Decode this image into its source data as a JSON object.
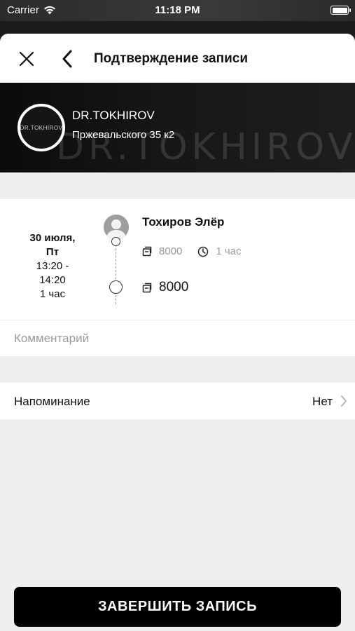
{
  "status_bar": {
    "carrier": "Carrier",
    "time": "11:18 PM"
  },
  "nav": {
    "title": "Подтверждение записи"
  },
  "banner": {
    "name": "DR.TOKHIROV",
    "address": "Пржевальского 35 к2",
    "avatar_text": "DR.TOKHIROV",
    "watermark": "DR.TOKHIROV"
  },
  "appointment": {
    "date": "30 июля,",
    "weekday": "Пт",
    "time_range_start": "13:20 -",
    "time_range_end": "14:20",
    "duration": "1 час",
    "master_name": "Тохиров Элёр",
    "service_price": "8000",
    "service_duration": "1 час",
    "total_price": "8000"
  },
  "comment": {
    "placeholder": "Комментарий"
  },
  "reminder": {
    "label": "Напоминание",
    "value": "Нет"
  },
  "actions": {
    "finish_label": "ЗАВЕРШИТЬ ЗАПИСЬ"
  },
  "colors": {
    "accent": "#000000",
    "background": "#efefef",
    "muted_text": "#9a9a9a"
  }
}
